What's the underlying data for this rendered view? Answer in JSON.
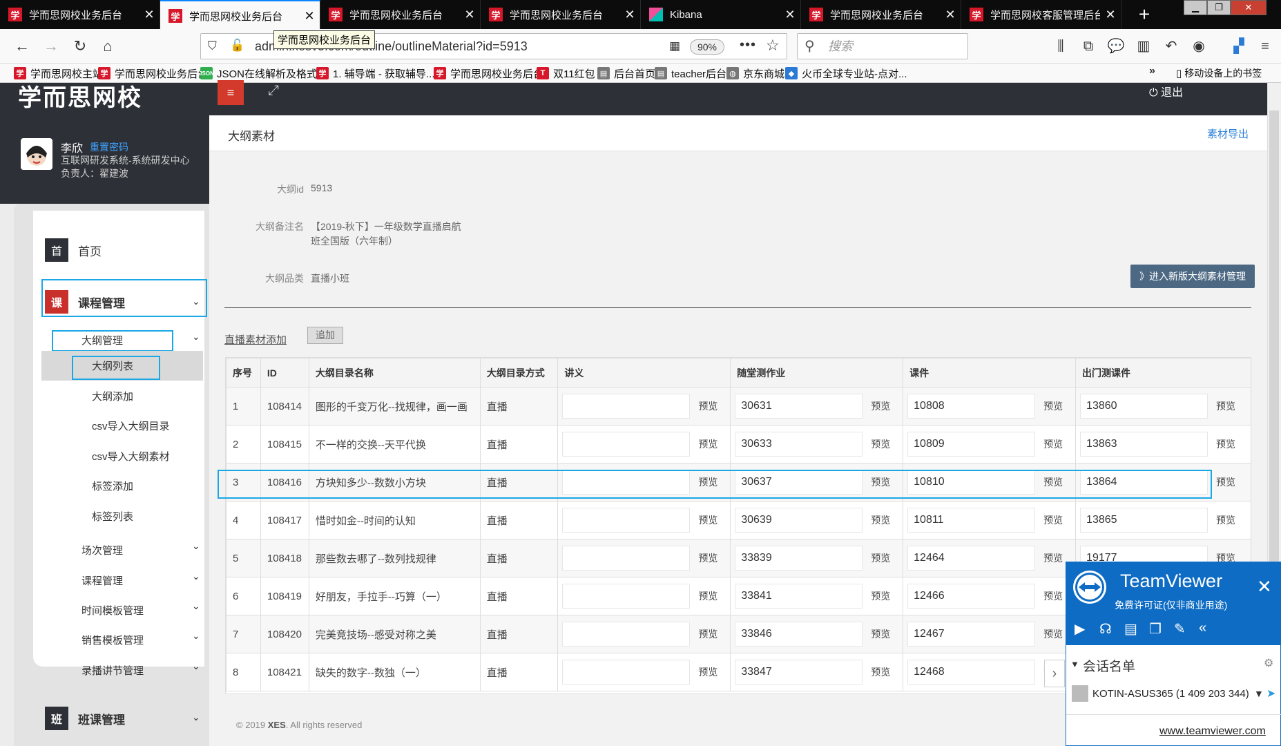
{
  "browser": {
    "tabs": [
      {
        "label": "学而思网校业务后台",
        "icon": "xes-favicon"
      },
      {
        "label": "学而思网校业务后台",
        "icon": "xes-favicon",
        "active": true
      },
      {
        "label": "学而思网校业务后台",
        "icon": "xes-favicon"
      },
      {
        "label": "学而思网校业务后台",
        "icon": "xes-favicon"
      },
      {
        "label": "Kibana",
        "icon": "kibana-favicon"
      },
      {
        "label": "学而思网校业务后台",
        "icon": "xes-favicon"
      },
      {
        "label": "学而思网校客服管理后台",
        "icon": "xes-favicon"
      }
    ],
    "url": "admin.xesv5.com/outline/outlineMaterial?id=5913",
    "zoom": "90%",
    "tooltip": "学而思网校业务后台",
    "search_placeholder": "搜索",
    "bookmarks": [
      {
        "label": "学而思网校主站",
        "icon": "xes"
      },
      {
        "label": "学而思网校业务后台",
        "icon": "xes"
      },
      {
        "label": "JSON在线解析及格式...",
        "icon": "json"
      },
      {
        "label": "1. 辅导端 - 获取辅导...",
        "icon": "xes"
      },
      {
        "label": "学而思网校业务后台",
        "icon": "xes"
      },
      {
        "label": "双11红包",
        "icon": "tmall"
      },
      {
        "label": "后台首页",
        "icon": "page"
      },
      {
        "label": "teacher后台",
        "icon": "page"
      },
      {
        "label": "京东商城",
        "icon": "globe"
      },
      {
        "label": "火币全球专业站-点对...",
        "icon": "huobi"
      }
    ],
    "mobile_bookmarks": "移动设备上的书签"
  },
  "app": {
    "logo": "学而思网校",
    "logout": "退出",
    "user": {
      "name": "李欣",
      "reset_password": "重置密码",
      "department": "互联网研发系统-系统研发中心",
      "owner": "负责人：翟建波"
    },
    "sidebar": {
      "home": {
        "badge": "首",
        "label": "首页"
      },
      "course": {
        "badge": "课",
        "label": "课程管理"
      },
      "outline_mgmt": "大纲管理",
      "outline_items": [
        "大纲列表",
        "大纲添加",
        "csv导入大纲目录",
        "csv导入大纲素材",
        "标签添加",
        "标签列表"
      ],
      "other_items": [
        "场次管理",
        "课程管理",
        "时间模板管理",
        "销售模板管理",
        "录播讲节管理"
      ],
      "class": {
        "badge": "班",
        "label": "班课管理"
      }
    },
    "page_title": "大纲素材",
    "export_link": "素材导出",
    "info": {
      "id_label": "大纲id",
      "id_value": "5913",
      "note_label": "大纲备注名",
      "note_line1": "【2019-秋下】一年级数学直播启航",
      "note_line2": "班全国版（六年制）",
      "category_label": "大纲品类",
      "category_value": "直播小班"
    },
    "new_mgmt_button": "》进入新版大纲素材管理",
    "add_live_link": "直播素材添加",
    "add_button": "追加",
    "table": {
      "headers": [
        "序号",
        "ID",
        "大纲目录名称",
        "大纲目录方式",
        "讲义",
        "随堂测作业",
        "课件",
        "出门测课件"
      ],
      "preview": "预览",
      "rows": [
        [
          "1",
          "108414",
          "图形的千变万化--找规律，画一画",
          "直播",
          "",
          "30631",
          "10808",
          "13860"
        ],
        [
          "2",
          "108415",
          "不一样的交换--天平代换",
          "直播",
          "",
          "30633",
          "10809",
          "13863"
        ],
        [
          "3",
          "108416",
          "方块知多少--数数小方块",
          "直播",
          "",
          "30637",
          "10810",
          "13864"
        ],
        [
          "4",
          "108417",
          "惜时如金--时间的认知",
          "直播",
          "",
          "30639",
          "10811",
          "13865"
        ],
        [
          "5",
          "108418",
          "那些数去哪了--数列找规律",
          "直播",
          "",
          "33839",
          "12464",
          "19177"
        ],
        [
          "6",
          "108419",
          "好朋友，手拉手--巧算（一）",
          "直播",
          "",
          "33841",
          "12466",
          ""
        ],
        [
          "7",
          "108420",
          "完美竞技场--感受对称之美",
          "直播",
          "",
          "33846",
          "12467",
          ""
        ],
        [
          "8",
          "108421",
          "缺失的数字--数独（一）",
          "直播",
          "",
          "33847",
          "12468",
          ""
        ]
      ]
    },
    "footer_prefix": "© 2019",
    "footer_brand": "XES",
    "footer_suffix": ". All rights reserved"
  },
  "teamviewer": {
    "title": "TeamViewer",
    "subtitle": "免费许可证(仅非商业用途)",
    "sessions": "会话名单",
    "session_item": "KOTIN-ASUS365 (1 409 203 344)",
    "link": "www.teamviewer.com"
  },
  "colors": {
    "accent_red": "#d33a2c",
    "dark": "#2d3037",
    "highlight": "#1aa7e6",
    "tv_blue": "#0e6cc4"
  }
}
